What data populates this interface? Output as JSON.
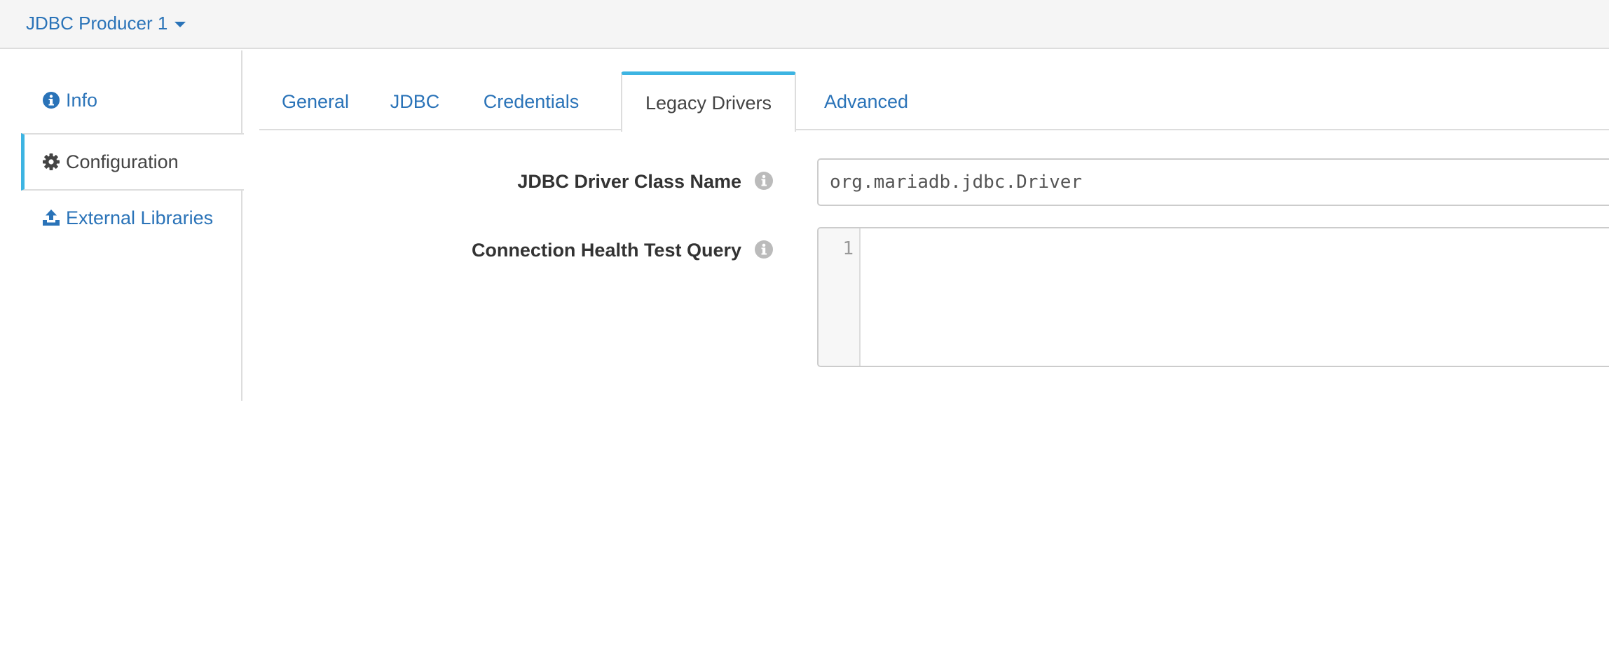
{
  "header": {
    "stage_name": "JDBC Producer 1"
  },
  "sidebar": {
    "items": [
      {
        "label": "Info",
        "icon": "info-circle-icon"
      },
      {
        "label": "Configuration",
        "icon": "gear-icon"
      },
      {
        "label": "External Libraries",
        "icon": "upload-icon"
      }
    ],
    "active": "Configuration"
  },
  "tabs": {
    "items": [
      "General",
      "JDBC",
      "Credentials",
      "Legacy Drivers",
      "Advanced"
    ],
    "active": "Legacy Drivers"
  },
  "form": {
    "driver_class": {
      "label": "JDBC Driver Class Name",
      "value": "org.mariadb.jdbc.Driver"
    },
    "health_query": {
      "label": "Connection Health Test Query",
      "line_number": "1",
      "value": ""
    }
  },
  "colors": {
    "link": "#2a73b8",
    "accent": "#3db4e2",
    "border": "#dddddd",
    "header_bg": "#f5f5f5"
  }
}
